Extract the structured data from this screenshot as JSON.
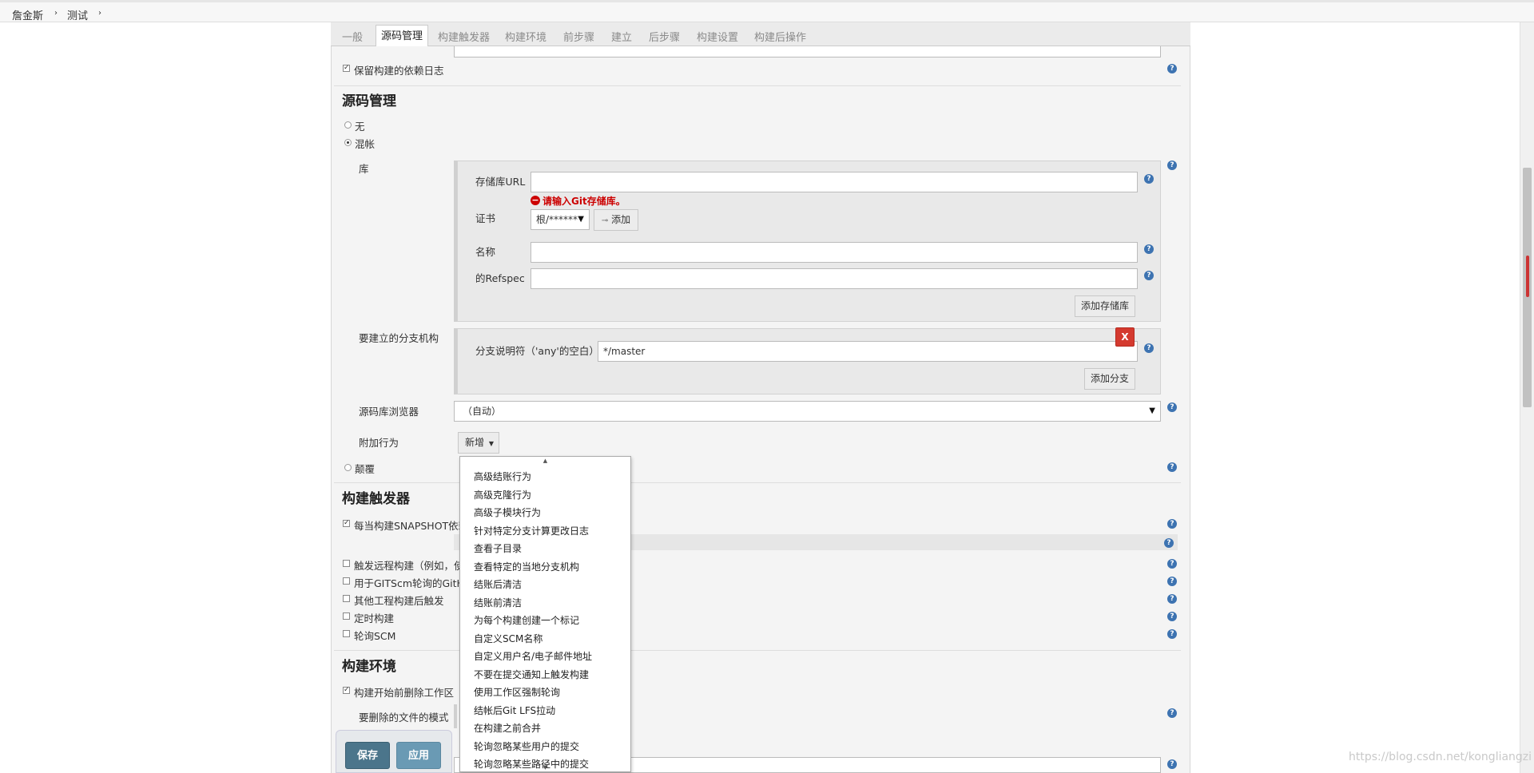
{
  "breadcrumb": [
    "詹金斯",
    "测试"
  ],
  "tabs": [
    "一般",
    "源码管理",
    "构建触发器",
    "构建环境",
    "前步骤",
    "建立",
    "后步骤",
    "构建设置",
    "构建后操作"
  ],
  "general": {
    "keep_deps_log": "保留构建的依赖日志"
  },
  "scm": {
    "title": "源码管理",
    "option_none": "无",
    "option_git": "混帐",
    "repos_label": "库",
    "repo_url_label": "存储库URL",
    "repo_url_value": "",
    "repo_url_error": "请输入Git存储库。",
    "credentials_label": "证书",
    "credentials_value": "根/******",
    "add_label": "添加",
    "name_label": "名称",
    "name_value": "",
    "refspec_label": "的Refspec",
    "refspec_value": "",
    "add_repo_button": "添加存储库",
    "branches_label": "要建立的分支机构",
    "branch_spec_label": "分支说明符（'any'的空白）",
    "branch_spec_value": "*/master",
    "remove_branch": "X",
    "add_branch_button": "添加分支",
    "browser_label": "源码库浏览器",
    "browser_value": "（自动）",
    "behaviours_label": "附加行为",
    "add_behaviour_button": "新增",
    "option_subversion": "颠覆"
  },
  "behaviours_menu": [
    "高级结账行为",
    "高级克隆行为",
    "高级子模块行为",
    "针对特定分支计算更改日志",
    "查看子目录",
    "查看特定的当地分支机构",
    "结账后清洁",
    "结账前清洁",
    "为每个构建创建一个标记",
    "自定义SCM名称",
    "自定义用户名/电子邮件地址",
    "不要在提交通知上触发构建",
    "使用工作区强制轮询",
    "结帐后Git LFS拉动",
    "在构建之前合并",
    "轮询忽略某些用户的提交",
    "轮询忽略某些路径中的提交"
  ],
  "triggers": {
    "title": "构建触发器",
    "snapshot": "每当构建SNAPSHOT依赖",
    "remote": "触发远程构建（例如，使",
    "github": "用于GITScm轮询的GitHu",
    "after_other": "其他工程构建后触发",
    "periodic": "定时构建",
    "poll_scm": "轮询SCM"
  },
  "env": {
    "title": "构建环境",
    "delete_ws": "构建开始前删除工作区",
    "patterns_label": "要删除的文件的模式"
  },
  "footer": {
    "save": "保存",
    "apply": "应用"
  },
  "watermark": "https://blog.csdn.net/kongliangzi",
  "colors": {
    "primary_button": "#4b758b",
    "help_icon": "#3d73b1",
    "error": "#cc0000"
  }
}
